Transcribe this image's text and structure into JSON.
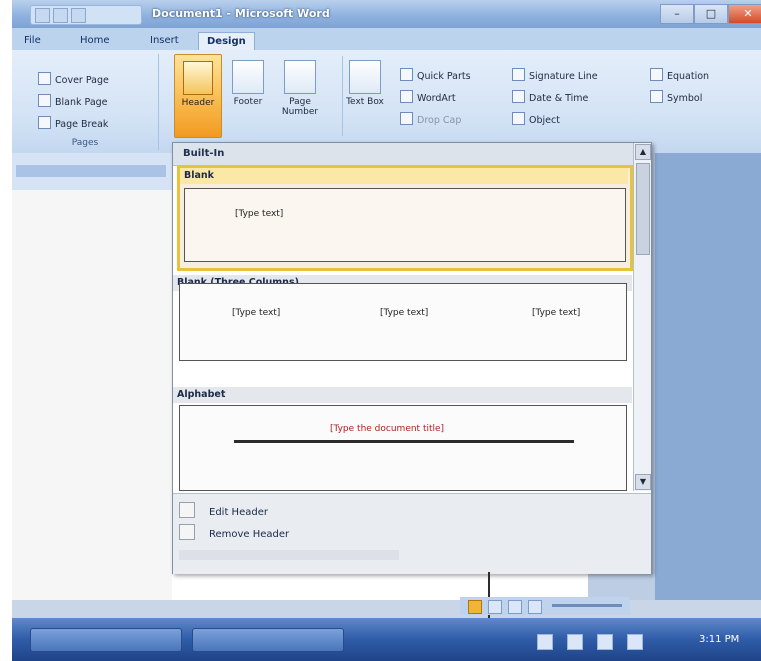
{
  "window": {
    "title": "Document1 - Microsoft Word"
  },
  "quick_access": {
    "items": [
      "save-icon",
      "undo-icon",
      "redo-icon"
    ]
  },
  "tabs": [
    {
      "label": "File"
    },
    {
      "label": "Home"
    },
    {
      "label": "Insert"
    },
    {
      "label": "Design"
    }
  ],
  "ribbon": {
    "pages_group": {
      "items": [
        {
          "label": "Cover Page",
          "icon": "cover-page-icon"
        },
        {
          "label": "Blank Page",
          "icon": "blank-page-icon"
        },
        {
          "label": "Page Break",
          "icon": "page-break-icon"
        }
      ],
      "label": "Pages"
    },
    "header_button": {
      "label": "Header"
    },
    "footer_button": {
      "label": "Footer"
    },
    "page_number_button": {
      "label": "Page Number"
    },
    "text_box_button": {
      "label": "Text Box"
    },
    "text_group": {
      "col1": [
        "Quick Parts",
        "WordArt",
        "Drop Cap"
      ],
      "col2": [
        "Signature Line",
        "Date & Time",
        "Object"
      ],
      "col3": [
        "Equation",
        "Symbol"
      ]
    }
  },
  "gallery": {
    "heading": "Built-In",
    "sections": [
      {
        "label": "Blank",
        "placeholders": [
          "[Type text]"
        ]
      },
      {
        "label": "Blank (Three Columns)",
        "placeholders": [
          "[Type text]",
          "[Type text]",
          "[Type text]"
        ]
      },
      {
        "label": "Alphabet",
        "placeholders": [
          "[Type the document title]"
        ]
      }
    ],
    "footer_items": [
      {
        "label": "Edit Header",
        "icon": "edit-header-icon"
      },
      {
        "label": "Remove Header",
        "icon": "remove-header-icon"
      }
    ]
  },
  "taskbar": {
    "clock": "3:11 PM",
    "tray_icons": [
      "network-icon",
      "volume-icon",
      "flag-icon",
      "battery-icon"
    ]
  },
  "colors": {
    "accent": "#f29a22",
    "ribbon": "#d2e2f5",
    "selection": "#e7c33a",
    "taskbar": "#2f5ca8"
  }
}
